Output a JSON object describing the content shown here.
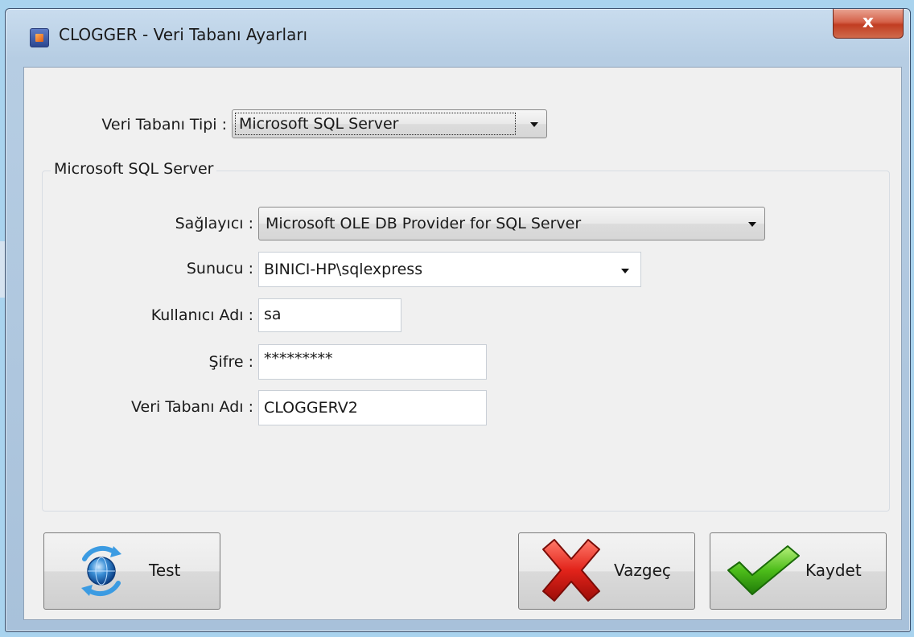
{
  "window": {
    "title": "CLOGGER - Veri Tabanı Ayarları",
    "close_glyph": "x"
  },
  "db_type": {
    "label": "Veri Tabanı Tipi :",
    "value": "Microsoft SQL Server"
  },
  "group": {
    "title": "Microsoft SQL Server",
    "provider": {
      "label": "Sağlayıcı :",
      "value": "Microsoft OLE DB Provider for SQL Server"
    },
    "server": {
      "label": "Sunucu :",
      "value": "BINICI-HP\\sqlexpress"
    },
    "username": {
      "label": "Kullanıcı Adı :",
      "value": "sa"
    },
    "password": {
      "label": "Şifre :",
      "value": "*********"
    },
    "database": {
      "label": "Veri Tabanı Adı :",
      "value": "CLOGGERV2"
    }
  },
  "buttons": {
    "test": {
      "label": "Test",
      "icon": "refresh-globe-icon"
    },
    "cancel": {
      "label": "Vazgeç",
      "icon": "red-x-icon"
    },
    "save": {
      "label": "Kaydet",
      "icon": "green-check-icon"
    }
  },
  "colors": {
    "desktop": "#a9d3ee",
    "close_button": "#c13d22",
    "client_bg": "#f0f0f0"
  }
}
